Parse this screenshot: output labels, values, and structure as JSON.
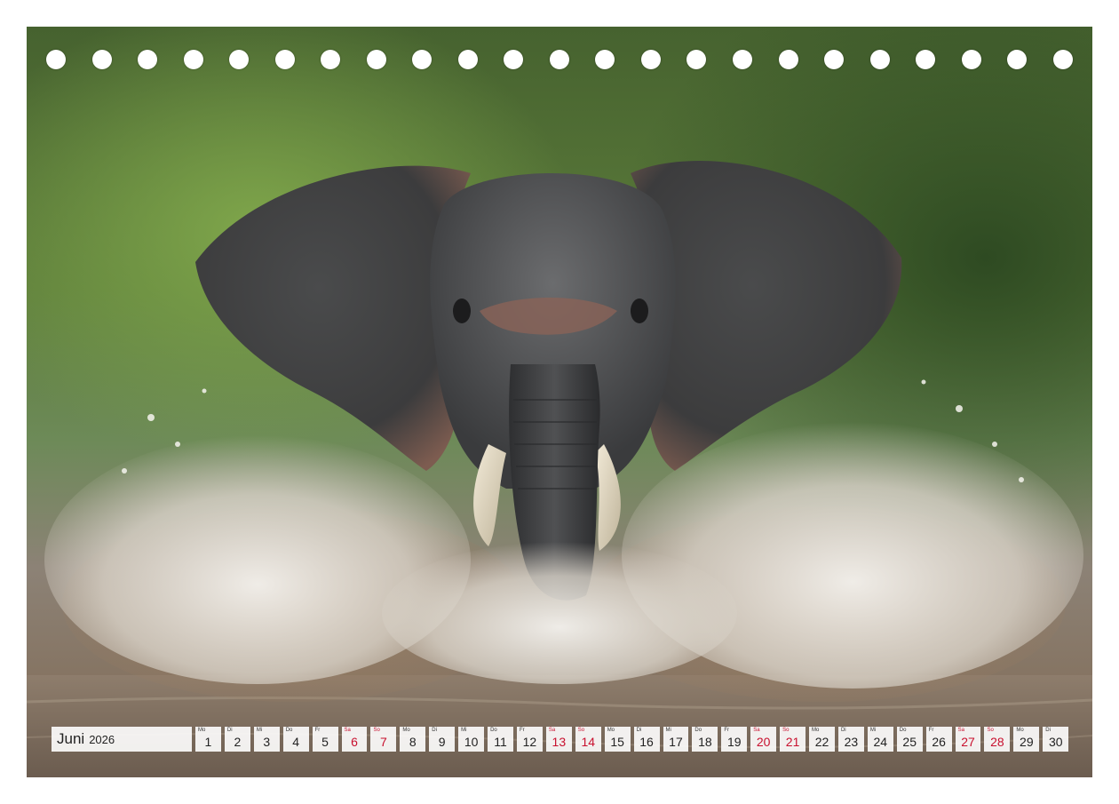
{
  "calendar": {
    "month": "Juni",
    "year": "2026",
    "days": [
      {
        "wd": "Mo",
        "num": "1",
        "weekend": false
      },
      {
        "wd": "Di",
        "num": "2",
        "weekend": false
      },
      {
        "wd": "Mi",
        "num": "3",
        "weekend": false
      },
      {
        "wd": "Do",
        "num": "4",
        "weekend": false
      },
      {
        "wd": "Fr",
        "num": "5",
        "weekend": false
      },
      {
        "wd": "Sa",
        "num": "6",
        "weekend": true
      },
      {
        "wd": "So",
        "num": "7",
        "weekend": true
      },
      {
        "wd": "Mo",
        "num": "8",
        "weekend": false
      },
      {
        "wd": "Di",
        "num": "9",
        "weekend": false
      },
      {
        "wd": "Mi",
        "num": "10",
        "weekend": false
      },
      {
        "wd": "Do",
        "num": "11",
        "weekend": false
      },
      {
        "wd": "Fr",
        "num": "12",
        "weekend": false
      },
      {
        "wd": "Sa",
        "num": "13",
        "weekend": true
      },
      {
        "wd": "So",
        "num": "14",
        "weekend": true
      },
      {
        "wd": "Mo",
        "num": "15",
        "weekend": false
      },
      {
        "wd": "Di",
        "num": "16",
        "weekend": false
      },
      {
        "wd": "Mi",
        "num": "17",
        "weekend": false
      },
      {
        "wd": "Do",
        "num": "18",
        "weekend": false
      },
      {
        "wd": "Fr",
        "num": "19",
        "weekend": false
      },
      {
        "wd": "Sa",
        "num": "20",
        "weekend": true
      },
      {
        "wd": "So",
        "num": "21",
        "weekend": true
      },
      {
        "wd": "Mo",
        "num": "22",
        "weekend": false
      },
      {
        "wd": "Di",
        "num": "23",
        "weekend": false
      },
      {
        "wd": "Mi",
        "num": "24",
        "weekend": false
      },
      {
        "wd": "Do",
        "num": "25",
        "weekend": false
      },
      {
        "wd": "Fr",
        "num": "26",
        "weekend": false
      },
      {
        "wd": "Sa",
        "num": "27",
        "weekend": true
      },
      {
        "wd": "So",
        "num": "28",
        "weekend": true
      },
      {
        "wd": "Mo",
        "num": "29",
        "weekend": false
      },
      {
        "wd": "Di",
        "num": "30",
        "weekend": false
      }
    ]
  },
  "photo": {
    "subject": "elephant-splashing-in-river"
  },
  "colors": {
    "weekend": "#c8102e",
    "cell_bg": "#ffffff",
    "text": "#222222"
  }
}
